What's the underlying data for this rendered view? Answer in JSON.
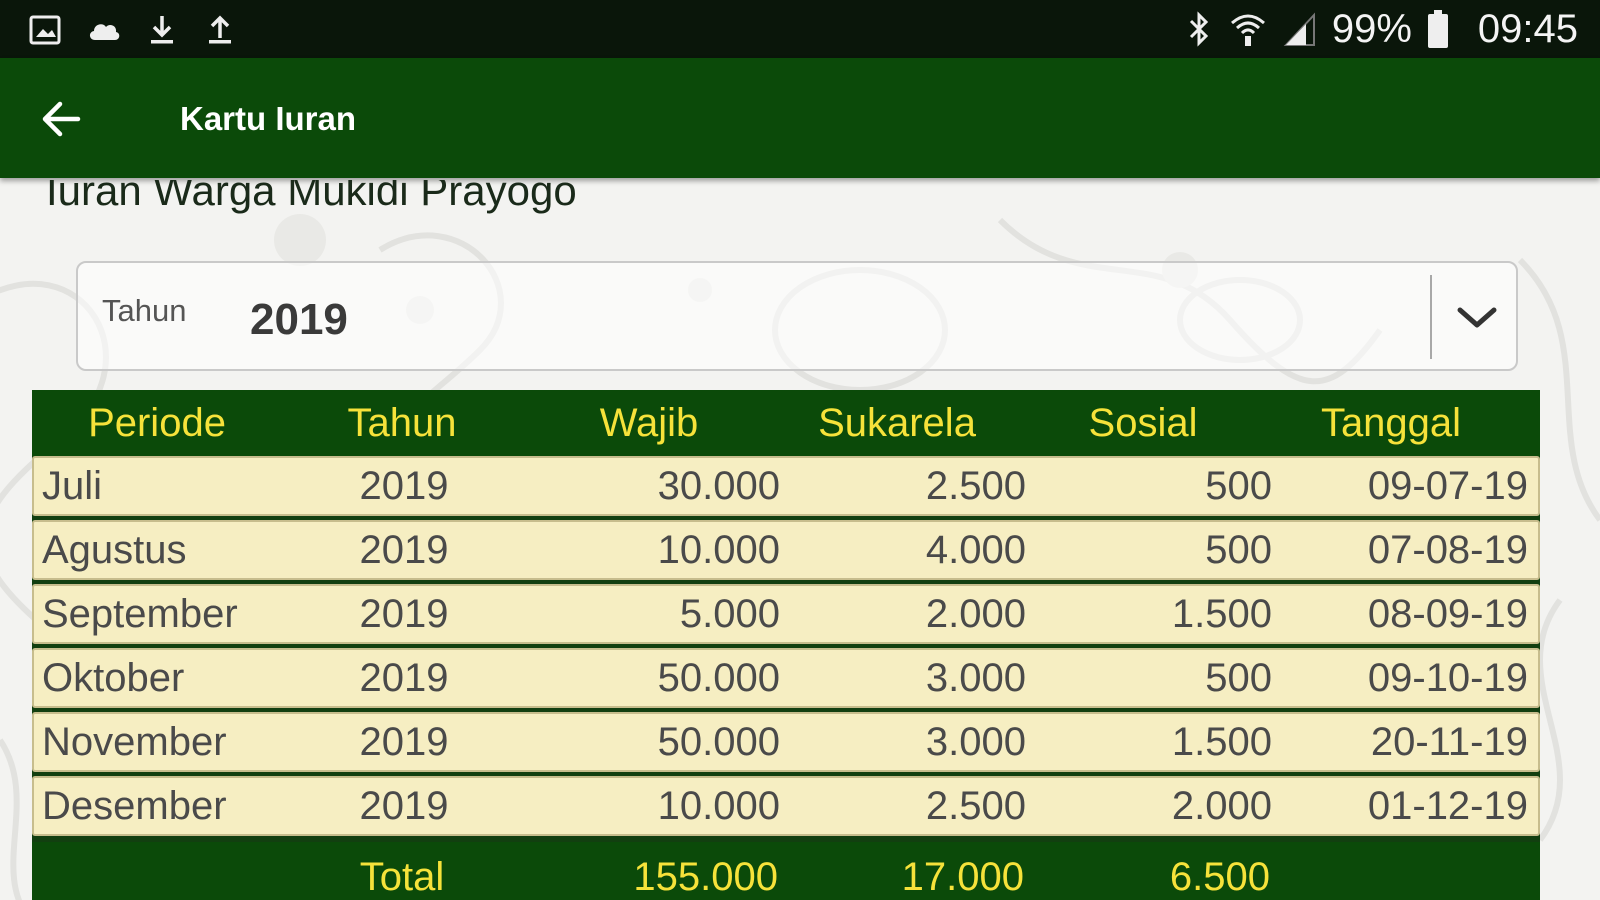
{
  "status_bar": {
    "battery": "99%",
    "time": "09:45",
    "left_icons": [
      "gallery-icon",
      "cloud-icon",
      "download-icon",
      "upload-icon"
    ],
    "right_icons": [
      "bluetooth-icon",
      "wifi-icon",
      "signal-icon",
      "battery-icon"
    ]
  },
  "app_bar": {
    "title": "Kartu Iuran",
    "background": "#0b4a09"
  },
  "subtitle": "Iuran Warga  Mukidi Prayogo",
  "year_picker": {
    "label": "Tahun",
    "value": "2019"
  },
  "table": {
    "header_color": "#0b4a09",
    "header_text_color": "#f6e23a",
    "row_color": "#f6eec2",
    "columns": [
      "Periode",
      "Tahun",
      "Wajib",
      "Sukarela",
      "Sosial",
      "Tanggal"
    ],
    "rows": [
      {
        "periode": "Juli",
        "tahun": "2019",
        "wajib": "30.000",
        "sukarela": "2.500",
        "sosial": "500",
        "tanggal": "09-07-19"
      },
      {
        "periode": "Agustus",
        "tahun": "2019",
        "wajib": "10.000",
        "sukarela": "4.000",
        "sosial": "500",
        "tanggal": "07-08-19"
      },
      {
        "periode": "September",
        "tahun": "2019",
        "wajib": "5.000",
        "sukarela": "2.000",
        "sosial": "1.500",
        "tanggal": "08-09-19"
      },
      {
        "periode": "Oktober",
        "tahun": "2019",
        "wajib": "50.000",
        "sukarela": "3.000",
        "sosial": "500",
        "tanggal": "09-10-19"
      },
      {
        "periode": "November",
        "tahun": "2019",
        "wajib": "50.000",
        "sukarela": "3.000",
        "sosial": "1.500",
        "tanggal": "20-11-19"
      },
      {
        "periode": "Desember",
        "tahun": "2019",
        "wajib": "10.000",
        "sukarela": "2.500",
        "sosial": "2.000",
        "tanggal": "01-12-19"
      }
    ],
    "total": {
      "label": "Total",
      "wajib": "155.000",
      "sukarela": "17.000",
      "sosial": "6.500"
    }
  }
}
